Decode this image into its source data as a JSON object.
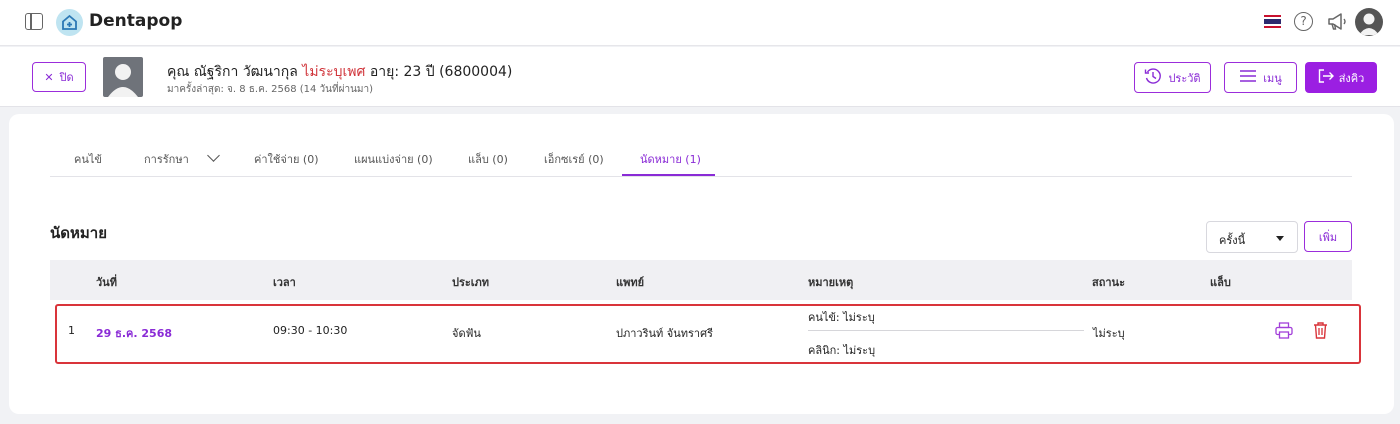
{
  "app": {
    "brand": "Dentapop"
  },
  "patient": {
    "close_label": "ปิด",
    "name": "คุณ ณัฐริกา วัฒนากุล",
    "gender": "ไม่ระบุเพศ",
    "age_id": "อายุ: 23 ปี  (6800004)",
    "last_visit": "มาครั้งล่าสุด: จ. 8 ธ.ค. 2568 (14 วันที่ผ่านมา)",
    "history_label": "ประวัติ",
    "menu_label": "เมนู",
    "send_label": "ส่งคิว"
  },
  "tabs": [
    {
      "label": "คนไข้"
    },
    {
      "label": "การรักษา"
    },
    {
      "label": "ค่าใช้จ่าย (0)"
    },
    {
      "label": "แผนแบ่งจ่าย (0)"
    },
    {
      "label": "แล็บ (0)"
    },
    {
      "label": "เอ็กซเรย์ (0)"
    },
    {
      "label": "นัดหมาย (1)",
      "active": true
    }
  ],
  "appointments": {
    "title": "นัดหมาย",
    "filter_selected": "ครั้งนี้",
    "add_label": "เพิ่ม",
    "columns": [
      "วันที่",
      "เวลา",
      "ประเภท",
      "แพทย์",
      "หมายเหตุ",
      "สถานะ",
      "แล็บ"
    ],
    "rows": [
      {
        "index": "1",
        "date": "29 ธ.ค. 2568",
        "time": "09:30 - 10:30",
        "type": "จัดฟัน",
        "doctor": "ปภาวรินท์ จันทราศรี",
        "note_patient": "คนไข้: ไม่ระบุ",
        "note_clinic": "คลินิก: ไม่ระบุ",
        "status": "ไม่ระบุ"
      }
    ]
  },
  "colors": {
    "accent": "#8a2bd6",
    "primary_button": "#9b1fe2",
    "highlight": "#d9343a",
    "gender_text": "#d0343a"
  }
}
